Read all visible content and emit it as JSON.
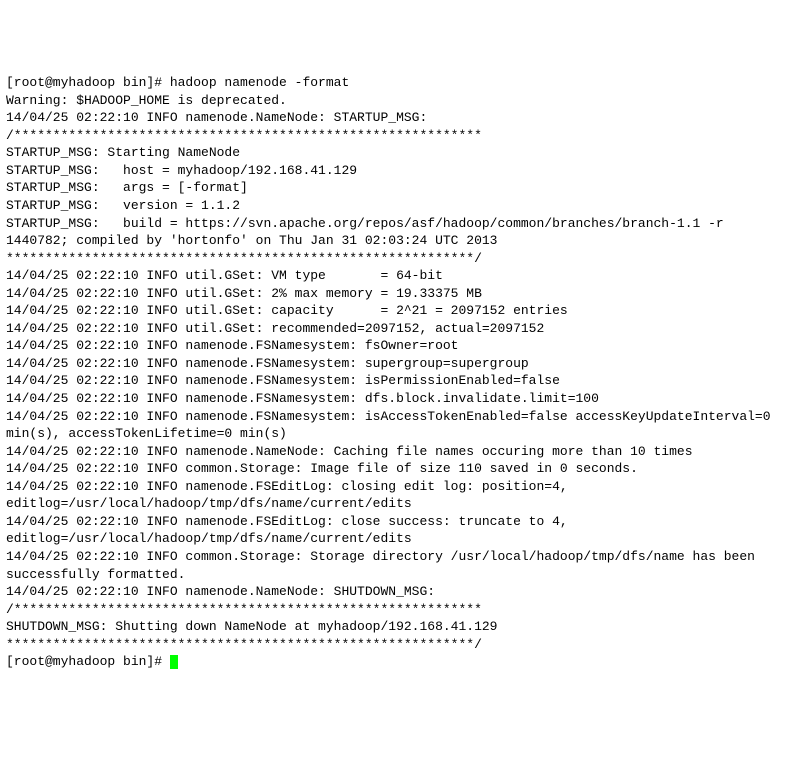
{
  "terminal": {
    "prompt1": "[root@myhadoop bin]# ",
    "command": "hadoop namenode -format",
    "lines": [
      "Warning: $HADOOP_HOME is deprecated.",
      "",
      "14/04/25 02:22:10 INFO namenode.NameNode: STARTUP_MSG:",
      "/************************************************************",
      "STARTUP_MSG: Starting NameNode",
      "STARTUP_MSG:   host = myhadoop/192.168.41.129",
      "STARTUP_MSG:   args = [-format]",
      "STARTUP_MSG:   version = 1.1.2",
      "STARTUP_MSG:   build = https://svn.apache.org/repos/asf/hadoop/common/branches/branch-1.1 -r 1440782; compiled by 'hortonfo' on Thu Jan 31 02:03:24 UTC 2013",
      "************************************************************/",
      "14/04/25 02:22:10 INFO util.GSet: VM type       = 64-bit",
      "14/04/25 02:22:10 INFO util.GSet: 2% max memory = 19.33375 MB",
      "14/04/25 02:22:10 INFO util.GSet: capacity      = 2^21 = 2097152 entries",
      "14/04/25 02:22:10 INFO util.GSet: recommended=2097152, actual=2097152",
      "14/04/25 02:22:10 INFO namenode.FSNamesystem: fsOwner=root",
      "14/04/25 02:22:10 INFO namenode.FSNamesystem: supergroup=supergroup",
      "14/04/25 02:22:10 INFO namenode.FSNamesystem: isPermissionEnabled=false",
      "14/04/25 02:22:10 INFO namenode.FSNamesystem: dfs.block.invalidate.limit=100",
      "14/04/25 02:22:10 INFO namenode.FSNamesystem: isAccessTokenEnabled=false accessKeyUpdateInterval=0 min(s), accessTokenLifetime=0 min(s)",
      "14/04/25 02:22:10 INFO namenode.NameNode: Caching file names occuring more than 10 times",
      "14/04/25 02:22:10 INFO common.Storage: Image file of size 110 saved in 0 seconds.",
      "14/04/25 02:22:10 INFO namenode.FSEditLog: closing edit log: position=4, editlog=/usr/local/hadoop/tmp/dfs/name/current/edits",
      "14/04/25 02:22:10 INFO namenode.FSEditLog: close success: truncate to 4, editlog=/usr/local/hadoop/tmp/dfs/name/current/edits",
      "14/04/25 02:22:10 INFO common.Storage: Storage directory /usr/local/hadoop/tmp/dfs/name has been successfully formatted.",
      "14/04/25 02:22:10 INFO namenode.NameNode: SHUTDOWN_MSG:",
      "/************************************************************",
      "SHUTDOWN_MSG: Shutting down NameNode at myhadoop/192.168.41.129",
      "************************************************************/"
    ],
    "prompt2": "[root@myhadoop bin]# "
  }
}
